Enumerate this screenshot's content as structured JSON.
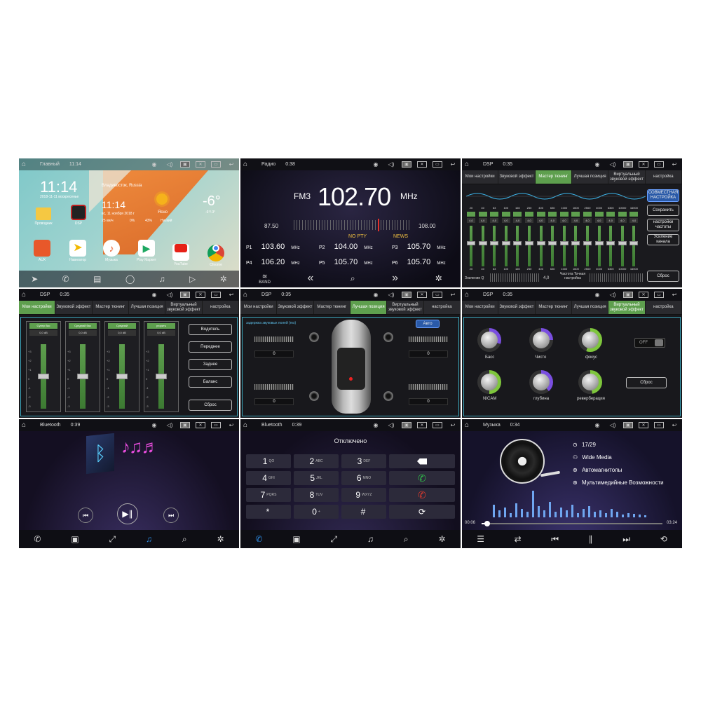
{
  "home": {
    "title": "Главный",
    "time": "11:14",
    "clock": "11:14",
    "date": "2018-11-11 воскресенье",
    "weather_city": "Владивосток, Russia",
    "weather_date": "вс, 11 ноября 2018 г",
    "weather_state": "Ясно",
    "temp": "-6°",
    "temp_range": "-6°/-3°",
    "wind": "25 км/ч",
    "humidity": "0%",
    "pressure": "43%",
    "uv": "Низкий",
    "apps": [
      "Проводник",
      "DSP",
      "AUX",
      "Навигатор",
      "Музыка",
      "Play Маркет",
      "YouTube",
      "Chrome"
    ]
  },
  "radio": {
    "title": "Радио",
    "time": "0:38",
    "band": "FM3",
    "freq": "102.70",
    "unit": "MHz",
    "scale_min": "87.50",
    "scale_max": "108.00",
    "pty": "NO PTY",
    "news": "NEWS",
    "presets": [
      {
        "label": "P1",
        "freq": "103.60"
      },
      {
        "label": "P2",
        "freq": "104.00"
      },
      {
        "label": "P3",
        "freq": "105.70"
      },
      {
        "label": "P4",
        "freq": "106.20"
      },
      {
        "label": "P5",
        "freq": "105.70"
      },
      {
        "label": "P6",
        "freq": "105.70"
      }
    ],
    "preset_unit": "MHz",
    "band_label": "BAND"
  },
  "dsp_tabs": [
    "Мои настройки",
    "Звуковой эффект",
    "Мастер тюнинг",
    "Лучшая позиция",
    "Виртуальный звуковой эффект",
    "настройка"
  ],
  "eq": {
    "title": "DSP",
    "time": "0:35",
    "freqs": [
      "20",
      "40",
      "63",
      "100",
      "160",
      "250",
      "400",
      "630",
      "1000",
      "1600",
      "2500",
      "4000",
      "6300",
      "10000",
      "16000"
    ],
    "buttons": [
      "СОВМЕСТНАЯ НАСТРОЙКА",
      "Сохранить",
      "настройки частоты",
      "Усиление канала",
      "Сброс"
    ],
    "q_label": "Значение Q",
    "q_value": "4,0",
    "freq_label": "Частота Точная настройка"
  },
  "effects": {
    "title": "DSP",
    "time": "0:35",
    "columns": [
      {
        "name": "Супер бас",
        "value": "0,0 dB"
      },
      {
        "name": "Средний бас",
        "value": "0,0 dB"
      },
      {
        "name": "Средний",
        "value": "0,0 dB"
      },
      {
        "name": "угорить",
        "value": "0,0 dB"
      }
    ],
    "scale": [
      "+3",
      "+2",
      "+1",
      "0",
      "-1",
      "-2",
      "-3"
    ],
    "buttons": [
      "Водитель",
      "Переднее",
      "Заднее",
      "Баланс",
      "Сброс"
    ]
  },
  "position": {
    "title": "DSP",
    "time": "0:35",
    "delay_label": "задержка звуковых полей (ms)",
    "auto": "Авто",
    "values": [
      "0",
      "0",
      "0",
      "0"
    ]
  },
  "virtual": {
    "title": "DSP",
    "time": "0:35",
    "knobs": [
      "Басс",
      "Чисто",
      "фокус",
      "NICAM",
      "глубина",
      "реверберация"
    ],
    "toggle": "OFF",
    "reset": "Сброс"
  },
  "bt1": {
    "title": "Bluetooth",
    "time": "0:39"
  },
  "bt2": {
    "title": "Bluetooth",
    "time": "0:39",
    "status": "Отключено",
    "keys": [
      {
        "d": "1",
        "s": "QO"
      },
      {
        "d": "2",
        "s": "ABC"
      },
      {
        "d": "3",
        "s": "DEF"
      },
      {
        "d": "4",
        "s": "GHI"
      },
      {
        "d": "5",
        "s": "JKL"
      },
      {
        "d": "6",
        "s": "MNO"
      },
      {
        "d": "7",
        "s": "PQRS"
      },
      {
        "d": "8",
        "s": "TUV"
      },
      {
        "d": "9",
        "s": "WXYZ"
      },
      {
        "d": "*",
        "s": ""
      },
      {
        "d": "0",
        "s": "+"
      },
      {
        "d": "#",
        "s": ""
      }
    ]
  },
  "music": {
    "title": "Музыка",
    "time": "0:34",
    "track_no": "17/29",
    "artist": "Wide Media",
    "album": "Автомагнитолы",
    "song": "Мультимедийные Возможности",
    "elapsed": "00:06",
    "total": "03:24",
    "progress": 0.03
  },
  "colors": {
    "accent_green": "#5e9f4e",
    "accent_blue": "#2e8ee8",
    "hangup_red": "#e23a2e",
    "call_green": "#2fbf4a"
  }
}
